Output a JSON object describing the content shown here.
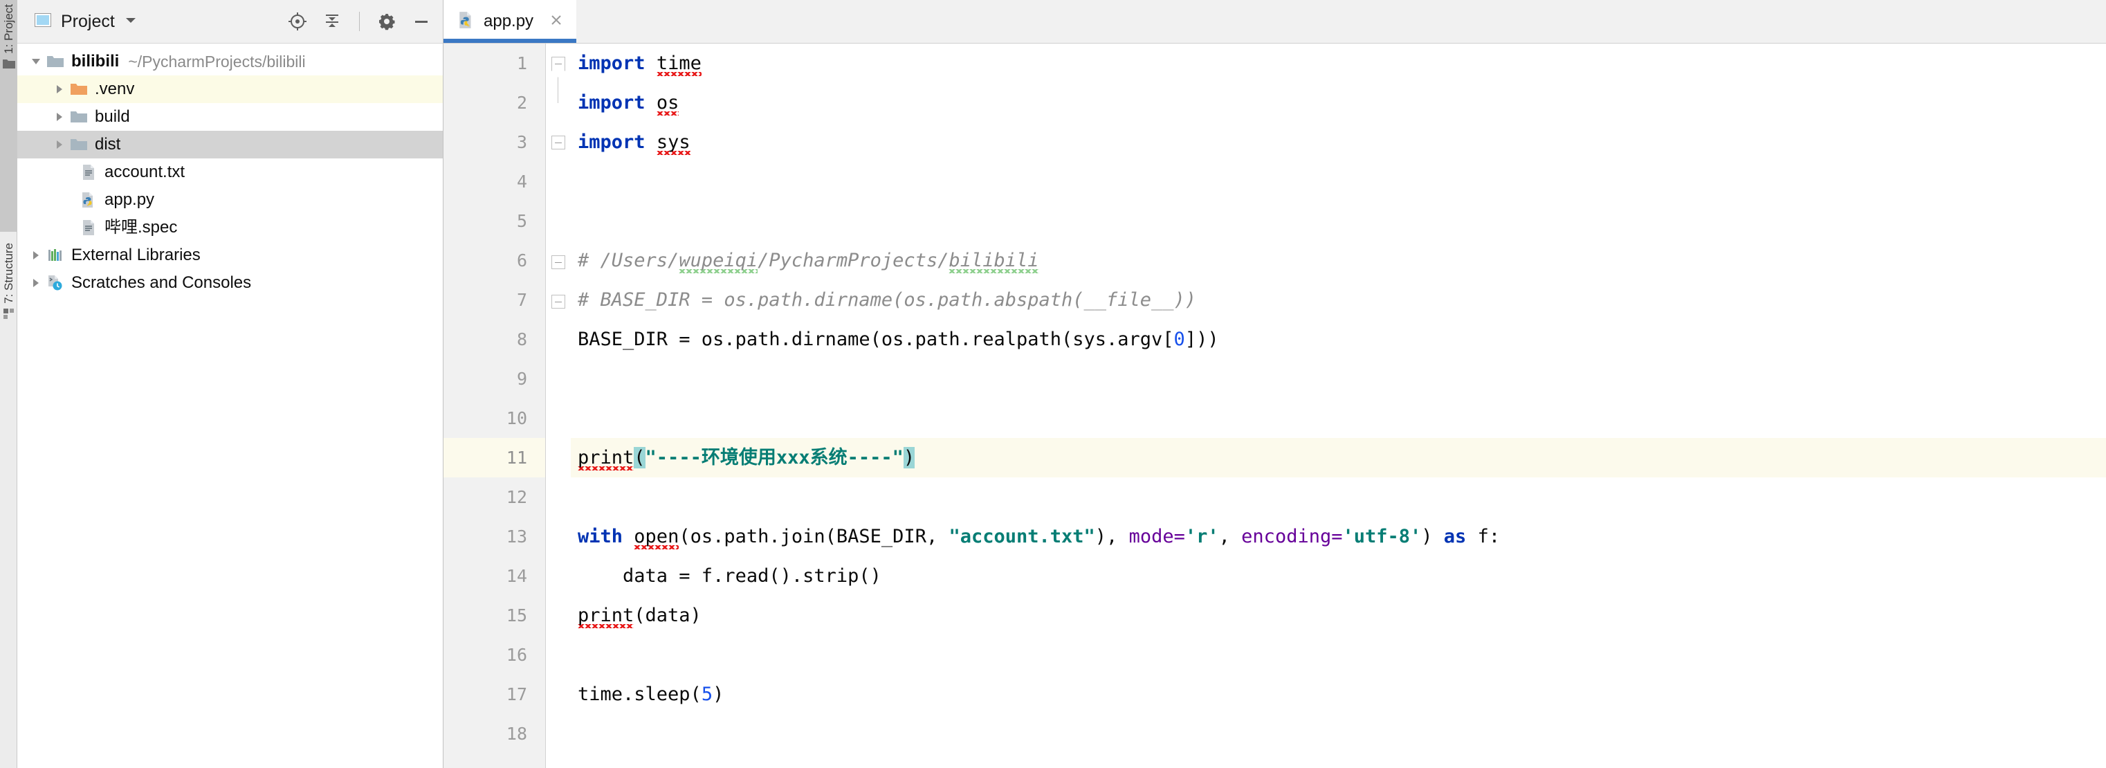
{
  "tool_strip": {
    "tabs": [
      {
        "label": "1: Project",
        "icon": "project-folder-icon",
        "active": true
      },
      {
        "label": "7: Structure",
        "icon": "structure-icon",
        "active": false
      }
    ]
  },
  "project_panel": {
    "title": "Project",
    "dropdown_icon": "chevron-down-icon",
    "panel_icon": "project-window-icon",
    "actions": [
      {
        "name": "locate-icon",
        "tooltip": "Select Opened File"
      },
      {
        "name": "collapse-all-icon",
        "tooltip": "Collapse All"
      },
      {
        "name": "gear-icon",
        "tooltip": "Settings"
      },
      {
        "name": "minimize-icon",
        "tooltip": "Hide"
      }
    ],
    "tree": [
      {
        "label": "bilibili",
        "path": "~/PycharmProjects/bilibili",
        "icon": "folder-icon",
        "twisty": "expanded",
        "indent": 0,
        "bold": true,
        "highlight": "none"
      },
      {
        "label": ".venv",
        "path": "",
        "icon": "folder-orange-icon",
        "twisty": "collapsed",
        "indent": 1,
        "bold": false,
        "highlight": "yellow"
      },
      {
        "label": "build",
        "path": "",
        "icon": "folder-icon",
        "twisty": "collapsed",
        "indent": 1,
        "bold": false,
        "highlight": "none"
      },
      {
        "label": "dist",
        "path": "",
        "icon": "folder-icon",
        "twisty": "collapsed",
        "indent": 1,
        "bold": false,
        "highlight": "gray"
      },
      {
        "label": "account.txt",
        "path": "",
        "icon": "text-file-icon",
        "twisty": "none",
        "indent": 2,
        "bold": false,
        "highlight": "none"
      },
      {
        "label": "app.py",
        "path": "",
        "icon": "python-file-icon",
        "twisty": "none",
        "indent": 2,
        "bold": false,
        "highlight": "none"
      },
      {
        "label": "哔哩.spec",
        "path": "",
        "icon": "text-file-icon",
        "twisty": "none",
        "indent": 2,
        "bold": false,
        "highlight": "none"
      },
      {
        "label": "External Libraries",
        "path": "",
        "icon": "libraries-icon",
        "twisty": "collapsed",
        "indent": 0,
        "bold": false,
        "highlight": "none"
      },
      {
        "label": "Scratches and Consoles",
        "path": "",
        "icon": "scratches-icon",
        "twisty": "collapsed",
        "indent": 0,
        "bold": false,
        "highlight": "none"
      }
    ]
  },
  "editor": {
    "tabs": [
      {
        "label": "app.py",
        "icon": "python-file-icon",
        "active": true,
        "close_icon": "close-icon"
      }
    ],
    "line_numbers": [
      "1",
      "2",
      "3",
      "4",
      "5",
      "6",
      "7",
      "8",
      "9",
      "10",
      "11",
      "12",
      "13",
      "14",
      "15",
      "16",
      "17",
      "18"
    ],
    "current_line": 11,
    "lines": [
      {
        "n": 1,
        "text": "import time"
      },
      {
        "n": 2,
        "text": "import os"
      },
      {
        "n": 3,
        "text": "import sys"
      },
      {
        "n": 4,
        "text": ""
      },
      {
        "n": 5,
        "text": ""
      },
      {
        "n": 6,
        "text": "# /Users/wupeiqi/PycharmProjects/bilibili"
      },
      {
        "n": 7,
        "text": "# BASE_DIR = os.path.dirname(os.path.abspath(__file__))"
      },
      {
        "n": 8,
        "text": "BASE_DIR = os.path.dirname(os.path.realpath(sys.argv[0]))"
      },
      {
        "n": 9,
        "text": ""
      },
      {
        "n": 10,
        "text": ""
      },
      {
        "n": 11,
        "text": "print(\"----环境使用xxx系统----\")"
      },
      {
        "n": 12,
        "text": ""
      },
      {
        "n": 13,
        "text": "with open(os.path.join(BASE_DIR, \"account.txt\"), mode='r', encoding='utf-8') as f:"
      },
      {
        "n": 14,
        "text": "    data = f.read().strip()"
      },
      {
        "n": 15,
        "text": "print(data)"
      },
      {
        "n": 16,
        "text": ""
      },
      {
        "n": 17,
        "text": "time.sleep(5)"
      },
      {
        "n": 18,
        "text": ""
      }
    ],
    "tokens": {
      "kw_import": "import",
      "mod_time": "time",
      "mod_os": "os",
      "mod_sys": "sys",
      "comment_6": "# /Users/wupeiqi/PycharmProjects/bilibili",
      "comment_6_a": "# /Users/",
      "comment_6_b": "wupeiqi",
      "comment_6_c": "/PycharmProjects/",
      "comment_6_d": "bilibili",
      "comment_7": "# BASE_DIR = os.path.dirname(os.path.abspath(__file__))",
      "line8_a": "BASE_DIR = os.path.dirname(os.path.realpath(sys.argv[",
      "line8_num": "0",
      "line8_b": "]))",
      "print_name": "print",
      "open_paren": "(",
      "close_paren": ")",
      "print_string": "\"----环境使用xxx系统----\"",
      "kw_with": "with",
      "fn_open": "open",
      "line13_a": "(os.path.join(BASE_DIR, ",
      "str_account": "\"account.txt\"",
      "line13_b": "), ",
      "kwarg_mode": "mode",
      "eq": "=",
      "str_r": "'r'",
      "comma_sp": ", ",
      "kwarg_encoding": "encoding",
      "str_utf8": "'utf-8'",
      "line13_c": ") ",
      "kw_as": "as",
      "line13_d": " f:",
      "line14": "    data = f.read().strip()",
      "line15_b": "(data)",
      "line17_a": "time.sleep(",
      "line17_num": "5",
      "line17_b": ")"
    }
  },
  "colors": {
    "keyword": "#0033b3",
    "string": "#067d74",
    "number": "#1750eb",
    "kwarg": "#660099",
    "comment": "#8c8c8c",
    "current_line_bg": "#fcfaec",
    "bracket_highlight": "#9ad6d6",
    "tab_underline": "#3b78c4",
    "selection_gray": "#d3d3d3",
    "selection_yellow": "#fcfbe6"
  }
}
